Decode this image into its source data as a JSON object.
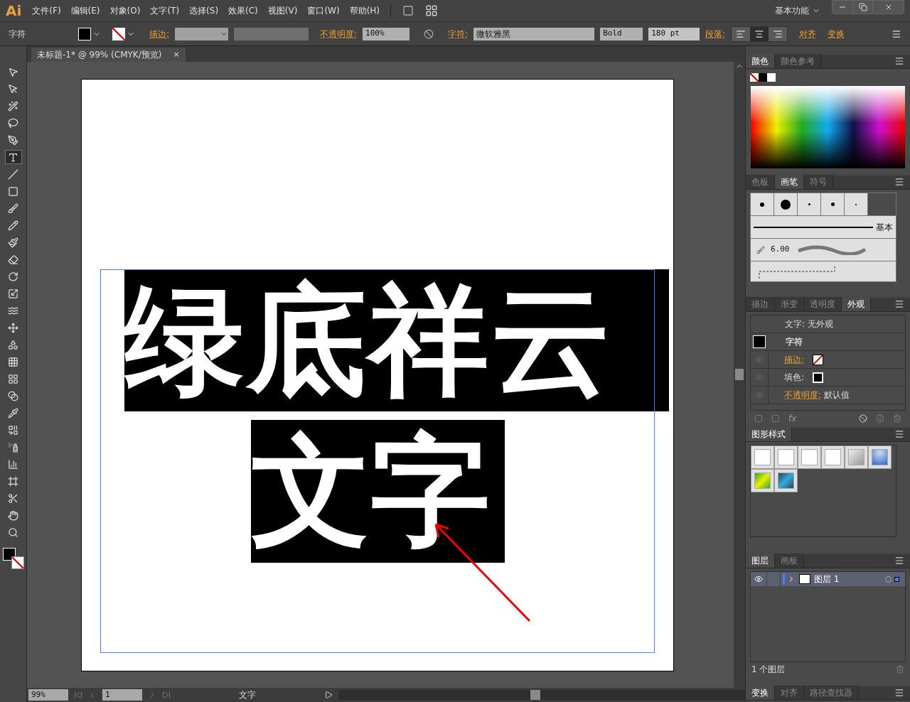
{
  "app": {
    "logo": "Ai",
    "workspace": "基本功能"
  },
  "menu": [
    "文件(F)",
    "编辑(E)",
    "对象(O)",
    "文字(T)",
    "选择(S)",
    "效果(C)",
    "视图(V)",
    "窗口(W)",
    "帮助(H)"
  ],
  "control_bar": {
    "panel_label": "字符",
    "stroke_label": "描边:",
    "opacity_label": "不透明度:",
    "opacity": "100%",
    "char_label": "字符:",
    "font": "微软雅黑",
    "style": "Bold",
    "size": "180 pt",
    "paragraph_label": "段落:",
    "align": [
      {
        "kind": "left",
        "selected": false
      },
      {
        "kind": "center",
        "selected": true
      },
      {
        "kind": "right",
        "selected": false
      }
    ],
    "links": [
      "对齐",
      "变换"
    ]
  },
  "document_tab": {
    "title": "未标题-1* @ 99% (CMYK/预览)",
    "close": "×"
  },
  "tools": [
    {
      "kind": "select",
      "selected": false
    },
    {
      "kind": "direct",
      "selected": false
    },
    {
      "kind": "wand",
      "selected": false
    },
    {
      "kind": "lasso",
      "selected": false
    },
    {
      "kind": "pen",
      "selected": false
    },
    {
      "kind": "type",
      "selected": true
    },
    {
      "kind": "line",
      "selected": false
    },
    {
      "kind": "rect",
      "selected": false
    },
    {
      "kind": "brush",
      "selected": false
    },
    {
      "kind": "pencil",
      "selected": false
    },
    {
      "kind": "blob",
      "selected": false
    },
    {
      "kind": "eraser",
      "selected": false
    },
    {
      "kind": "rotate",
      "selected": false
    },
    {
      "kind": "scale",
      "selected": false
    },
    {
      "kind": "warp",
      "selected": false
    },
    {
      "kind": "free",
      "selected": false
    },
    {
      "kind": "shape",
      "selected": false
    },
    {
      "kind": "grid",
      "selected": false
    },
    {
      "kind": "mesh",
      "selected": false
    },
    {
      "kind": "gradient",
      "selected": false
    },
    {
      "kind": "eyedropper",
      "selected": false
    },
    {
      "kind": "blend",
      "selected": false
    },
    {
      "kind": "spray",
      "selected": false
    },
    {
      "kind": "graph",
      "selected": false
    },
    {
      "kind": "artboard",
      "selected": false
    },
    {
      "kind": "slice",
      "selected": false
    },
    {
      "kind": "hand",
      "selected": false
    },
    {
      "kind": "zoom",
      "selected": false
    }
  ],
  "artboard": {
    "lines": [
      "绿底祥云",
      "文字"
    ]
  },
  "color_panel": {
    "tabs": [
      {
        "label": "颜色",
        "selected": true
      },
      {
        "label": "颜色参考",
        "selected": false
      }
    ]
  },
  "brush_panel": {
    "tabs": [
      {
        "label": "色板",
        "selected": false
      },
      {
        "label": "画笔",
        "selected": true
      },
      {
        "label": "符号",
        "selected": false
      }
    ],
    "basic": "基本",
    "size": "6.00"
  },
  "appearance_panel": {
    "tabs": [
      {
        "label": "描边",
        "selected": false
      },
      {
        "label": "渐变",
        "selected": false
      },
      {
        "label": "透明度",
        "selected": false
      },
      {
        "label": "外观",
        "selected": true
      }
    ],
    "header_label": "文字:",
    "header_value": "无外观",
    "group": "字符",
    "stroke": "描边:",
    "fill": "填色:",
    "opacity": "不透明度:",
    "opacity_value": "默认值",
    "fx": "fx"
  },
  "styles_panel": {
    "tabs": [
      {
        "label": "图形样式",
        "selected": true
      }
    ]
  },
  "layers_panel": {
    "tabs": [
      {
        "label": "图层",
        "selected": true
      },
      {
        "label": "画板",
        "selected": false
      }
    ],
    "layer": "图层 1",
    "footer": "1 个图层"
  },
  "bottom_panel": {
    "tabs": [
      {
        "label": "变换",
        "selected": true
      },
      {
        "label": "对齐",
        "selected": false
      },
      {
        "label": "路径查找器",
        "selected": false
      }
    ]
  },
  "status_bar": {
    "zoom": "99%",
    "page": "1",
    "tool": "文字"
  }
}
